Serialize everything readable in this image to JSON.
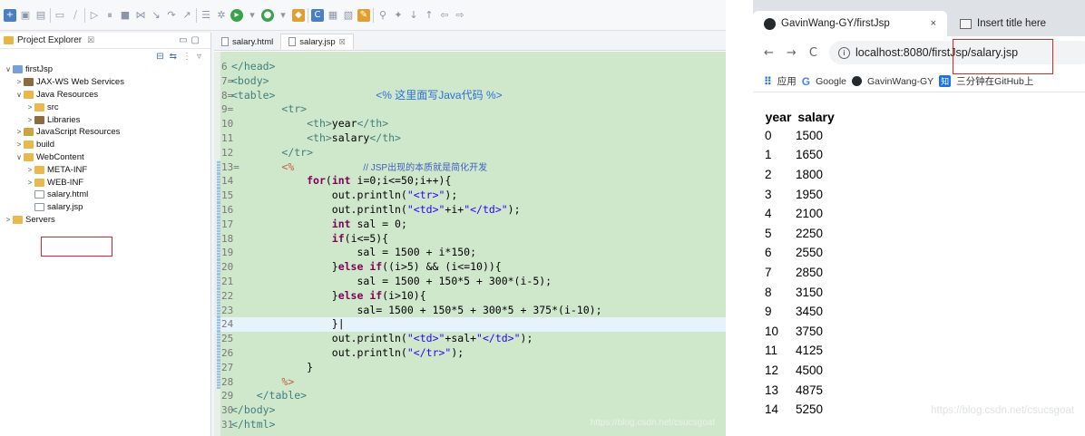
{
  "eclipse": {
    "explorer": {
      "title": "Project Explorer",
      "close": "☒",
      "tree": [
        {
          "arrow": "∨",
          "icon": "proj",
          "label": "firstJsp",
          "indent": 0
        },
        {
          "arrow": ">",
          "icon": "lib",
          "label": "JAX-WS Web Services",
          "indent": 1
        },
        {
          "arrow": "∨",
          "icon": "folder",
          "label": "Java Resources",
          "indent": 1
        },
        {
          "arrow": ">",
          "icon": "folder",
          "label": "src",
          "indent": 2
        },
        {
          "arrow": ">",
          "icon": "lib",
          "label": "Libraries",
          "indent": 2
        },
        {
          "arrow": ">",
          "icon": "js",
          "label": "JavaScript Resources",
          "indent": 1
        },
        {
          "arrow": ">",
          "icon": "folder",
          "label": "build",
          "indent": 1
        },
        {
          "arrow": "∨",
          "icon": "folder",
          "label": "WebContent",
          "indent": 1
        },
        {
          "arrow": ">",
          "icon": "folder",
          "label": "META-INF",
          "indent": 2
        },
        {
          "arrow": ">",
          "icon": "folder",
          "label": "WEB-INF",
          "indent": 2
        },
        {
          "arrow": "",
          "icon": "file",
          "label": "salary.html",
          "indent": 2
        },
        {
          "arrow": "",
          "icon": "file",
          "label": "salary.jsp",
          "indent": 2
        },
        {
          "arrow": ">",
          "icon": "folder",
          "label": "Servers",
          "indent": 0
        }
      ]
    },
    "tabs": [
      {
        "label": "salary.html",
        "active": false
      },
      {
        "label": "salary.jsp",
        "active": true,
        "close": "☒"
      }
    ],
    "watermark": "https://blog.csdn.net/csucsgoat"
  },
  "browser": {
    "tabs": [
      {
        "label": "GavinWang-GY/firstJsp",
        "close": "×"
      },
      {
        "label": "Insert title here"
      }
    ],
    "nav": {
      "back": "←",
      "forward": "→",
      "reload": "C"
    },
    "url": "localhost:8080/firstJsp/salary.jsp",
    "bookmarks": {
      "apps": "应用",
      "google": "Google",
      "github_user": "GavinWang-GY",
      "zhihu": "三分钟在GitHub上"
    },
    "table": {
      "headers": [
        "year",
        "salary"
      ],
      "rows": [
        [
          "0",
          "1500"
        ],
        [
          "1",
          "1650"
        ],
        [
          "2",
          "1800"
        ],
        [
          "3",
          "1950"
        ],
        [
          "4",
          "2100"
        ],
        [
          "5",
          "2250"
        ],
        [
          "6",
          "2550"
        ],
        [
          "7",
          "2850"
        ],
        [
          "8",
          "3150"
        ],
        [
          "9",
          "3450"
        ],
        [
          "10",
          "3750"
        ],
        [
          "11",
          "4125"
        ],
        [
          "12",
          "4500"
        ],
        [
          "13",
          "4875"
        ],
        [
          "14",
          "5250"
        ]
      ]
    },
    "watermark": "https://blog.csdn.net/csucsgoat"
  }
}
